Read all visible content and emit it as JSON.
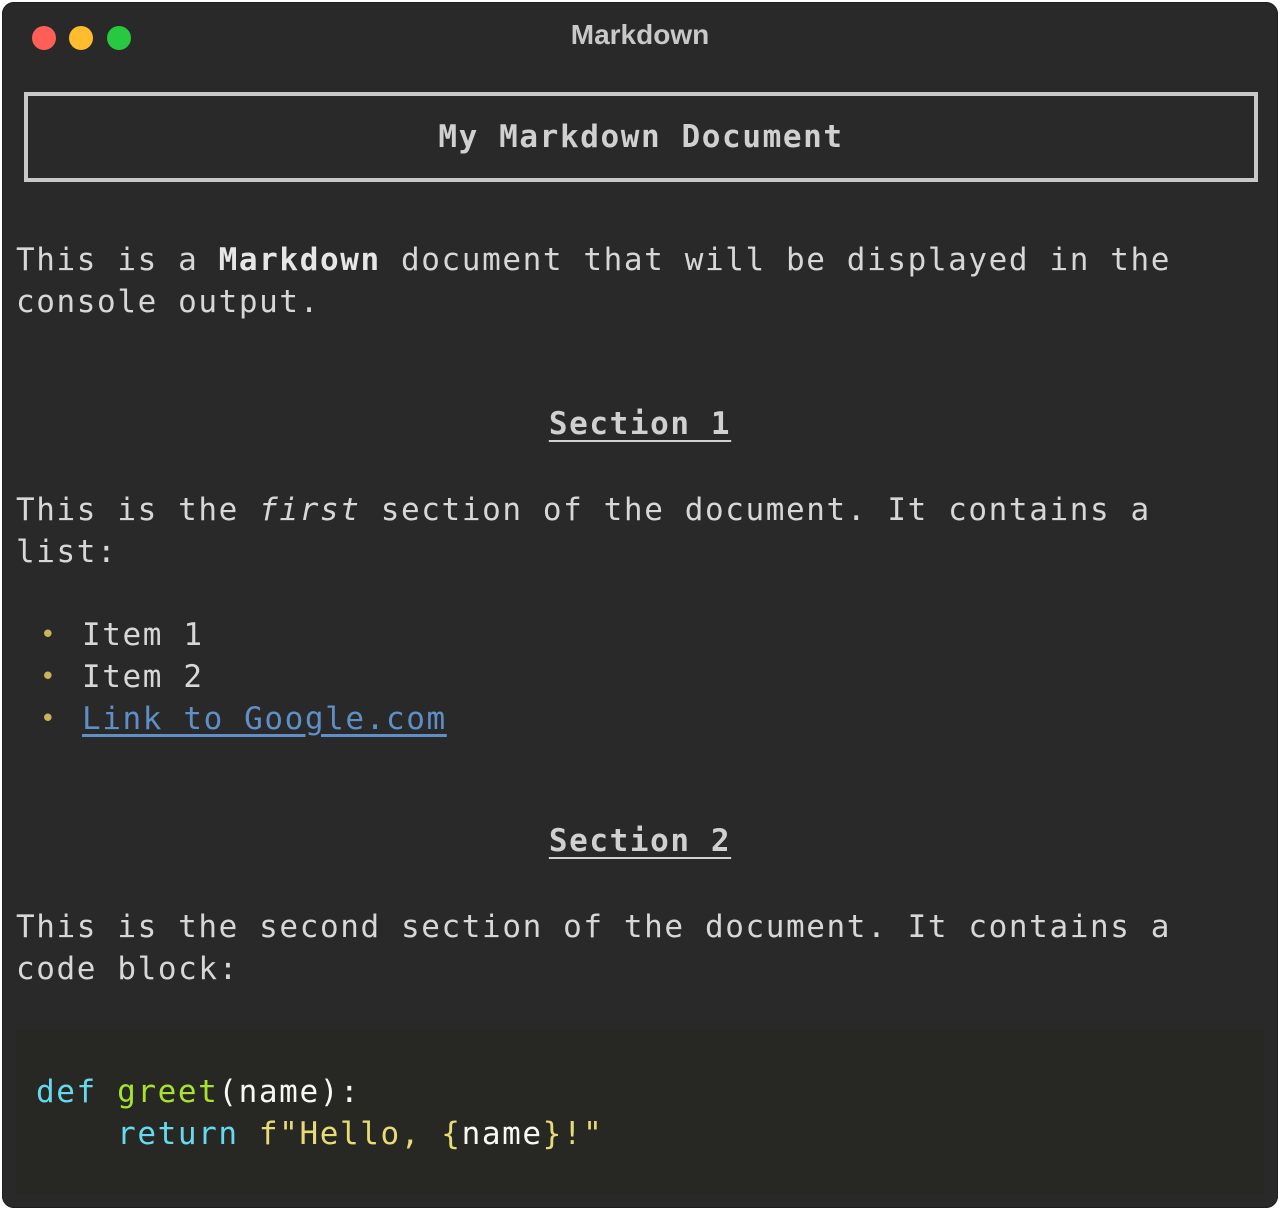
{
  "window": {
    "title": "Markdown"
  },
  "document": {
    "title": "My Markdown Document",
    "intro": {
      "before": "This is a ",
      "bold": "Markdown",
      "after": " document that will be displayed in the",
      "line2": "console output."
    },
    "section1": {
      "heading": "Section 1",
      "para": {
        "before": "This is the ",
        "italic": "first",
        "after": " section of the document. It contains a",
        "line2": "list:"
      },
      "bullet": "•",
      "items": [
        "Item 1",
        "Item 2"
      ],
      "link": "Link to Google.com"
    },
    "section2": {
      "heading": "Section 2",
      "para": {
        "line1": "This is the second section of the document. It contains a",
        "line2": "code block:"
      },
      "code": {
        "line1": {
          "kw": "def",
          "space": " ",
          "fn": "greet",
          "rest": "(name):"
        },
        "line2": {
          "indent": "    ",
          "kw": "return",
          "space": " ",
          "str1": "f\"Hello, {",
          "plain": "name",
          "str2": "}!\""
        }
      }
    }
  },
  "colors": {
    "background": "#292929",
    "text": "#d7d7d7",
    "link": "#5f8fc7",
    "bullet": "#c8b45a",
    "code_bg": "#272823",
    "code_keyword": "#66d9ef",
    "code_function": "#a6e22e",
    "code_string": "#e6db74"
  }
}
